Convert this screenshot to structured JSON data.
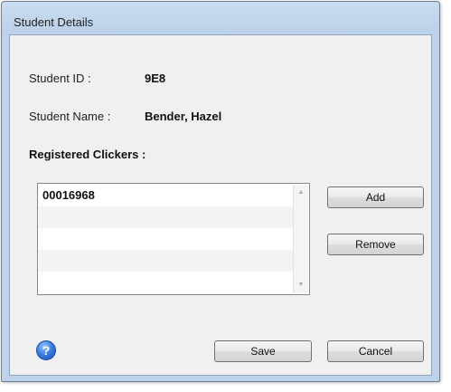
{
  "window": {
    "title": "Student Details"
  },
  "student": {
    "id_label": "Student ID :",
    "id_value": "9E8",
    "name_label": "Student Name :",
    "name_value": "Bender, Hazel"
  },
  "clickers": {
    "heading": "Registered Clickers :",
    "items": [
      "00016968",
      "",
      "",
      "",
      ""
    ]
  },
  "buttons": {
    "add": "Add",
    "remove": "Remove",
    "save": "Save",
    "cancel": "Cancel"
  },
  "help": {
    "glyph": "?"
  },
  "scroll": {
    "up": "▲",
    "down": "▼"
  },
  "colors": {
    "frame": "#bed3ea",
    "client": "#f0f0f0",
    "help_blue": "#3c7fe0"
  }
}
